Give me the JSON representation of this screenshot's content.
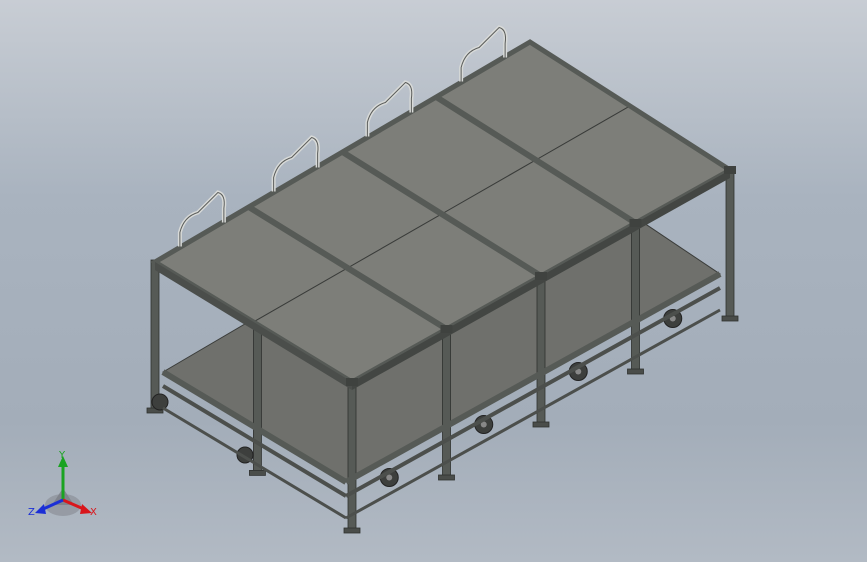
{
  "view": {
    "background_top": "#c8cdd4",
    "background_bottom": "#a3adb9"
  },
  "model": {
    "name": "double-deck-rack",
    "frame_color": "#565a56",
    "panel_color": "#7d7e79",
    "panel_edge_color": "#3a3c3a",
    "wheel_color": "#3d3f3d",
    "modules": 4
  },
  "triad": {
    "x_label": "X",
    "y_label": "Y",
    "z_label": "Z",
    "x_color": "#d9161b",
    "y_color": "#1aa321",
    "z_color": "#1b2fd6"
  }
}
